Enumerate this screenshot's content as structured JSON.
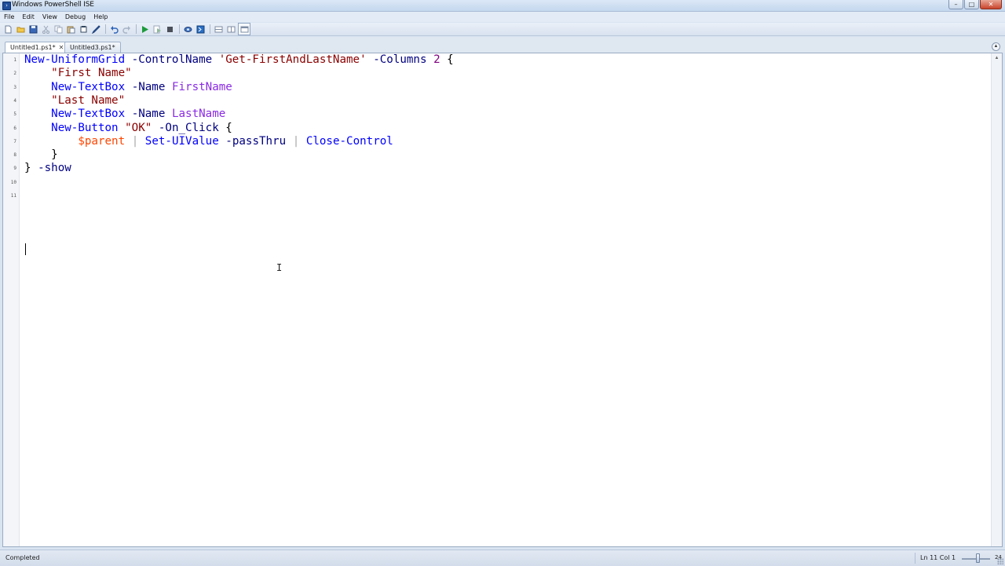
{
  "window": {
    "title": "Windows PowerShell ISE",
    "minimize": "–",
    "maximize": "□",
    "close": "✕"
  },
  "menu": [
    "File",
    "Edit",
    "View",
    "Debug",
    "Help"
  ],
  "toolbar": {
    "buttons": [
      "new-script",
      "open",
      "save",
      "cut",
      "copy",
      "paste",
      "clear",
      "undo",
      "redo",
      "run",
      "run-selection",
      "stop",
      "new-remote",
      "start-powershell",
      "show-script-top",
      "show-script-right",
      "show-script-max"
    ]
  },
  "tabs": [
    {
      "label": "Untitled1.ps1*",
      "close": "✕",
      "active": true
    },
    {
      "label": "Untitled3.ps1*",
      "active": false
    }
  ],
  "editor": {
    "line_numbers": [
      "1",
      "2",
      "3",
      "4",
      "5",
      "6",
      "7",
      "8",
      "9",
      "10",
      "11"
    ],
    "lines": [
      [
        [
          "cmd",
          "New-UniformGrid"
        ],
        [
          "txt",
          " "
        ],
        [
          "param",
          "-ControlName"
        ],
        [
          "txt",
          " "
        ],
        [
          "str",
          "'Get-FirstAndLastName'"
        ],
        [
          "txt",
          " "
        ],
        [
          "param",
          "-Columns"
        ],
        [
          "txt",
          " "
        ],
        [
          "num",
          "2"
        ],
        [
          "txt",
          " "
        ],
        [
          "grp",
          "{"
        ]
      ],
      [
        [
          "txt",
          "    "
        ],
        [
          "str",
          "\"First Name\""
        ]
      ],
      [
        [
          "txt",
          "    "
        ],
        [
          "cmd",
          "New-TextBox"
        ],
        [
          "txt",
          " "
        ],
        [
          "param",
          "-Name"
        ],
        [
          "txt",
          " "
        ],
        [
          "arg",
          "FirstName"
        ]
      ],
      [
        [
          "txt",
          "    "
        ],
        [
          "str",
          "\"Last Name\""
        ]
      ],
      [
        [
          "txt",
          "    "
        ],
        [
          "cmd",
          "New-TextBox"
        ],
        [
          "txt",
          " "
        ],
        [
          "param",
          "-Name"
        ],
        [
          "txt",
          " "
        ],
        [
          "arg",
          "LastName"
        ]
      ],
      [
        [
          "txt",
          "    "
        ],
        [
          "cmd",
          "New-Button"
        ],
        [
          "txt",
          " "
        ],
        [
          "str",
          "\"OK\""
        ],
        [
          "txt",
          " "
        ],
        [
          "param",
          "-On_Click"
        ],
        [
          "txt",
          " "
        ],
        [
          "grp",
          "{"
        ]
      ],
      [
        [
          "txt",
          "        "
        ],
        [
          "var",
          "$parent"
        ],
        [
          "txt",
          " "
        ],
        [
          "op",
          "|"
        ],
        [
          "txt",
          " "
        ],
        [
          "cmd",
          "Set-UIValue"
        ],
        [
          "txt",
          " "
        ],
        [
          "param",
          "-passThru"
        ],
        [
          "txt",
          " "
        ],
        [
          "op",
          "|"
        ],
        [
          "txt",
          " "
        ],
        [
          "cmd",
          "Close-Control"
        ]
      ],
      [
        [
          "txt",
          "    "
        ],
        [
          "grp",
          "}"
        ]
      ],
      [
        [
          "grp",
          "}"
        ],
        [
          "txt",
          " "
        ],
        [
          "param",
          "-show"
        ]
      ],
      [],
      []
    ]
  },
  "status": {
    "text": "Completed",
    "position": "Ln 11  Col 1",
    "zoom_value": "24",
    "zoom_level": 0.55
  }
}
